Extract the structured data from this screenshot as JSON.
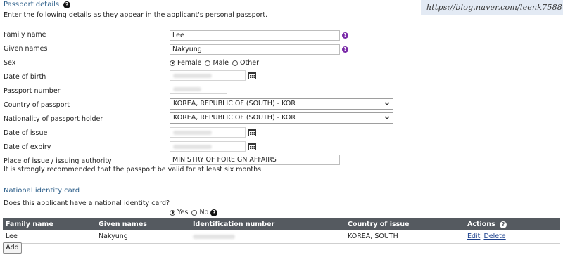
{
  "watermark": "https://blog.naver.com/leenk7588",
  "passport": {
    "title": "Passport details",
    "intro": "Enter the following details as they appear in the applicant's personal passport.",
    "family_name": {
      "label": "Family name",
      "value": "Lee"
    },
    "given_names": {
      "label": "Given names",
      "value": "Nakyung"
    },
    "sex": {
      "label": "Sex",
      "options": [
        "Female",
        "Male",
        "Other"
      ],
      "selected": "Female"
    },
    "dob": {
      "label": "Date of birth"
    },
    "passport_number": {
      "label": "Passport number"
    },
    "country": {
      "label": "Country of passport",
      "value": "KOREA, REPUBLIC OF (SOUTH) - KOR"
    },
    "nationality": {
      "label": "Nationality of passport holder",
      "value": "KOREA, REPUBLIC OF (SOUTH) - KOR"
    },
    "date_issue": {
      "label": "Date of issue"
    },
    "date_expiry": {
      "label": "Date of expiry"
    },
    "place_issue": {
      "label": "Place of issue / issuing authority",
      "value": "MINISTRY OF FOREIGN AFFAIRS"
    },
    "validity_note": "It is strongly recommended that the passport be valid for at least six months."
  },
  "national_id": {
    "title": "National identity card",
    "question": "Does this applicant have a national identity card?",
    "yes": "Yes",
    "no": "No",
    "selected": "Yes",
    "columns": [
      "Family name",
      "Given names",
      "Identification number",
      "Country of issue",
      "Actions"
    ],
    "rows": [
      {
        "family_name": "Lee",
        "given_names": "Nakyung",
        "country": "KOREA, SOUTH"
      }
    ],
    "edit": "Edit",
    "delete": "Delete",
    "add": "Add"
  },
  "colors": {
    "section_title": "#2d5f8a",
    "table_header": "#555a60",
    "help_purple": "#7a2aa8",
    "watermark_bg": "#e3eaf4"
  },
  "icons": [
    "help-icon",
    "calendar-icon",
    "chevron-down-icon"
  ]
}
